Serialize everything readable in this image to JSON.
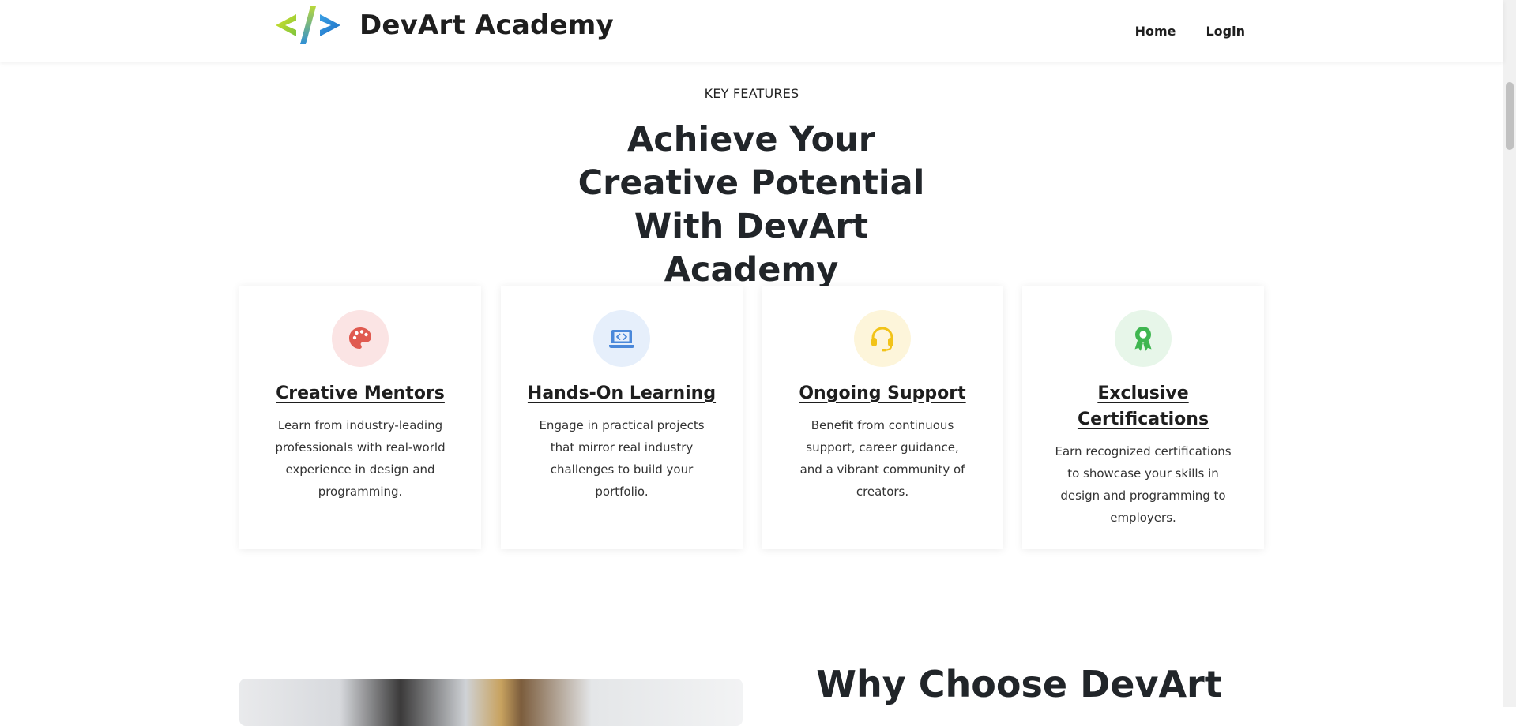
{
  "header": {
    "brand_name": "DevArt Academy",
    "logo_icon": "code-brackets-logo",
    "nav": [
      {
        "label": "Home"
      },
      {
        "label": "Login"
      }
    ]
  },
  "features": {
    "eyebrow": "KEY FEATURES",
    "headline": "Achieve Your Creative Potential With DevArt Academy",
    "cards": [
      {
        "icon": "palette-icon",
        "icon_color": "#e05a50",
        "icon_bg": "#fbe4e4",
        "title": "Creative Mentors",
        "text": "Learn from industry-leading professionals with real-world experience in design and programming."
      },
      {
        "icon": "laptop-code-icon",
        "icon_color": "#4a88da",
        "icon_bg": "#e6effb",
        "title": "Hands-On Learning",
        "text": "Engage in practical projects that mirror real industry challenges to build your portfolio."
      },
      {
        "icon": "headset-icon",
        "icon_color": "#f2c318",
        "icon_bg": "#fdf5da",
        "title": "Ongoing Support",
        "text": "Benefit from continuous support, career guidance, and a vibrant community of creators."
      },
      {
        "icon": "award-icon",
        "icon_color": "#3fb650",
        "icon_bg": "#e7f6e9",
        "title": "Exclusive Certifications",
        "text": "Earn recognized certifications to showcase your skills in design and programming to employers."
      }
    ]
  },
  "why": {
    "title": "Why Choose DevArt"
  }
}
